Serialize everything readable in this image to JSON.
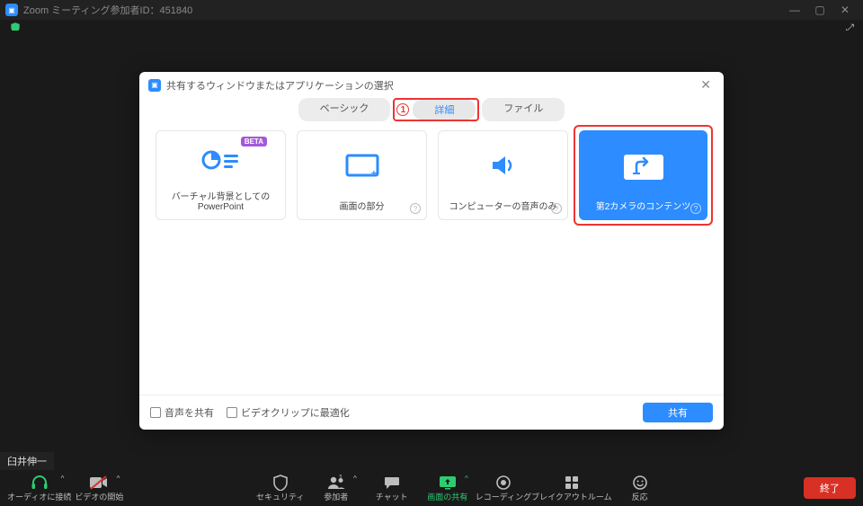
{
  "window": {
    "title": "Zoom ミーティング参加者ID：451840",
    "min": "—",
    "max": "▢",
    "close": "✕"
  },
  "participant_name": "臼井伸一",
  "modal": {
    "title": "共有するウィンドウまたはアプリケーションの選択",
    "close": "✕",
    "annot_badge": "1",
    "tabs": {
      "basic": "ベーシック",
      "advanced": "詳細",
      "file": "ファイル"
    },
    "options": {
      "vb_ppt": {
        "label": "バーチャル背景としてのPowerPoint",
        "beta": "BETA"
      },
      "portion": {
        "label": "画面の部分"
      },
      "audio_only": {
        "label": "コンピューターの音声のみ"
      },
      "second_cam": {
        "label": "第2カメラのコンテンツ"
      }
    },
    "footer": {
      "share_audio": "音声を共有",
      "optimize_video": "ビデオクリップに最適化",
      "share_btn": "共有"
    }
  },
  "toolbar": {
    "audio": "オーディオに接続",
    "video": "ビデオの開始",
    "security": "セキュリティ",
    "participants": "参加者",
    "participants_count": "1",
    "chat": "チャット",
    "share_screen": "画面の共有",
    "record": "レコーディング",
    "breakout": "ブレイクアウトルーム",
    "reactions": "反応",
    "end": "終了"
  }
}
